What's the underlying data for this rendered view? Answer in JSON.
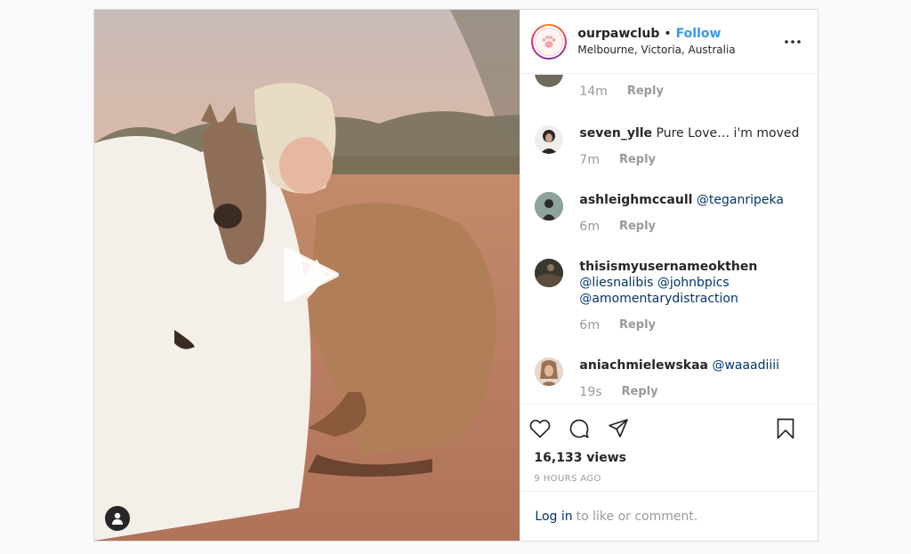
{
  "header": {
    "username": "ourpawclub",
    "separator": "•",
    "follow_label": "Follow",
    "location": "Melbourne, Victoria, Australia"
  },
  "comments": [
    {
      "time": "14m",
      "reply_label": "Reply"
    },
    {
      "username": "seven_ylle",
      "text": "Pure Love… i'm moved",
      "time": "7m",
      "reply_label": "Reply"
    },
    {
      "username": "ashleighmccaull",
      "mentions": "@teganripeka",
      "time": "6m",
      "reply_label": "Reply"
    },
    {
      "username": "thisismyusernameokthen",
      "mention_line1": "@liesnalibis @johnbpics",
      "mention_line2": "@amomentarydistraction",
      "time": "6m",
      "reply_label": "Reply"
    },
    {
      "username": "aniachmielewskaa",
      "mentions": "@waaadiiii",
      "time": "19s",
      "reply_label": "Reply"
    }
  ],
  "actions": {
    "like_icon": "heart-icon",
    "comment_icon": "speech-bubble-icon",
    "share_icon": "paper-plane-icon",
    "save_icon": "bookmark-icon",
    "views": "16,133 views",
    "time_ago": "9 HOURS AGO"
  },
  "login": {
    "link_label": "Log in",
    "suffix": "to like or comment."
  },
  "colors": {
    "link_blue": "#3897f0",
    "mention_blue": "#003569",
    "text": "#262626",
    "muted": "#999999",
    "border": "#dbdbdb"
  }
}
